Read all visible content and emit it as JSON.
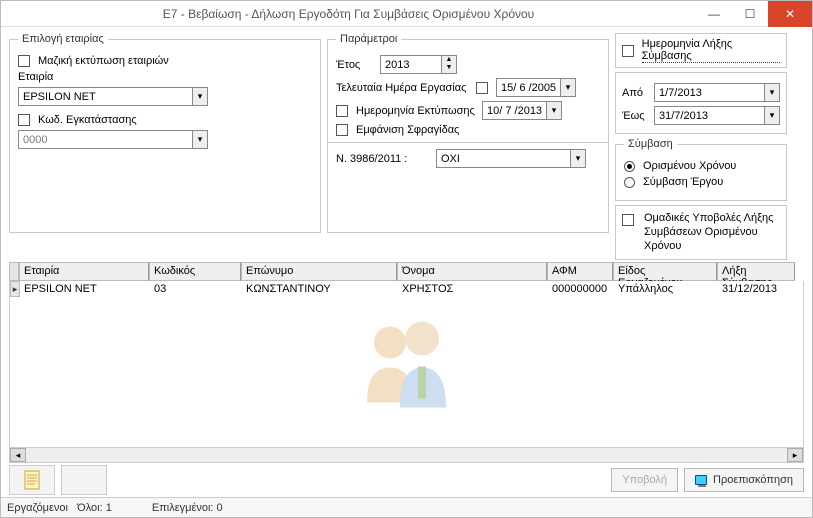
{
  "window": {
    "title": "Ε7 - Βεβαίωση - Δήλωση Εργοδότη Για Συμβάσεις Ορισμένου Χρόνου"
  },
  "company": {
    "legend": "Επιλογή εταιρίας",
    "mass_print_label": "Μαζική εκτύπωση εταιριών",
    "company_label": "Εταιρία",
    "company_value": "EPSILON NET",
    "install_code_label": "Κωδ. Εγκατάστασης",
    "install_code_value": "0000"
  },
  "params": {
    "legend": "Παράμετροι",
    "year_label": "Έτος",
    "year_value": "2013",
    "last_workday_label": "Τελευταία Ημέρα Εργασίας",
    "last_workday_value": "15/ 6 /2005",
    "print_date_label": "Ημερομηνία Εκτύπωσης",
    "print_date_value": "10/ 7 /2013",
    "show_stamp_label": "Εμφάνιση Σφραγίδας",
    "law_label": "Ν. 3986/2011 :",
    "law_value": "ΟΧΙ"
  },
  "rightcol": {
    "end_date_label": "Ημερομηνία Λήξης Σύμβασης",
    "from_label": "Από",
    "from_value": "1/7/2013",
    "to_label": "Έως",
    "to_value": "31/7/2013",
    "contract_legend": "Σύμβαση",
    "opt_fixed": "Ορισμένου Χρόνου",
    "opt_project": "Σύμβαση Έργου",
    "group_submit_label": "Ομαδικές Υποβολές Λήξης Συμβάσεων Ορισμένου Χρόνου"
  },
  "grid": {
    "headers": {
      "company": "Εταιρία",
      "code": "Κωδικός",
      "surname": "Επώνυμο",
      "name": "Όνομα",
      "afm": "ΑΦΜ",
      "kind": "Είδος Εργαζομένου",
      "expiry": "Λήξη Σύμβασης"
    },
    "rows": [
      {
        "company": "EPSILON NET",
        "code": "03",
        "surname": "ΚΩΝΣΤΑΝΤΙΝΟΥ",
        "name": "ΧΡΗΣΤΟΣ",
        "afm": "000000000",
        "kind": "Υπάλληλος",
        "expiry": "31/12/2013"
      }
    ]
  },
  "toolbar": {
    "submit": "Υποβολή",
    "preview": "Προεπισκόπηση"
  },
  "status": {
    "employees_label": "Εργαζόμενοι",
    "all": "Όλοι: 1",
    "selected": "Επιλεγμένοι: 0"
  }
}
